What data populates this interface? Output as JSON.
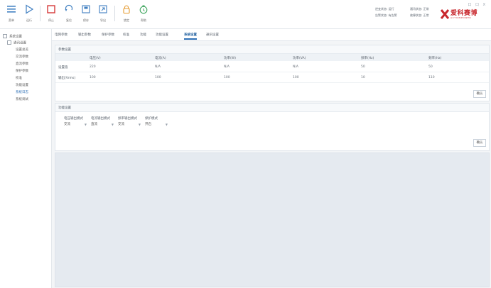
{
  "toolbar": {
    "items": [
      {
        "label": "菜单",
        "icon": "menu-icon",
        "color": "#3f7fc1"
      },
      {
        "label": "运行",
        "icon": "play-icon",
        "color": "#3f7fc1"
      },
      {
        "label": "停止",
        "icon": "stop-icon",
        "color": "#d63a3a"
      },
      {
        "label": "复位",
        "icon": "reset-icon",
        "color": "#3f7fc1"
      },
      {
        "label": "保存",
        "icon": "save-icon",
        "color": "#3f7fc1"
      },
      {
        "label": "导出",
        "icon": "export-icon",
        "color": "#3f7fc1"
      },
      {
        "label": "锁定",
        "icon": "lock-icon",
        "color": "#e59a2f"
      },
      {
        "label": "帮助",
        "icon": "help-icon",
        "color": "#3aa45a"
      }
    ]
  },
  "status": {
    "line1_left": "逆变状态: 运行",
    "line1_right": "通讯状态: 正常",
    "line2_left": "告警状态: 有告警",
    "line2_right": "故障状态: 正常"
  },
  "window_controls": "口 口 X",
  "logo": {
    "brand": "爱科赛博",
    "sub": "ACTIONPOWER",
    "accent": "#c8262c"
  },
  "sidebar": {
    "root": "系统设置",
    "group": "通讯设置",
    "items": [
      "设置总览",
      "交流参数",
      "直流参数",
      "保护参数",
      "校准",
      "功能设置",
      "系统日志",
      "系统调试"
    ]
  },
  "tabs": [
    "电网参数",
    "输出参数",
    "保护参数",
    "校准",
    "功能",
    "功能设置",
    "系统设置",
    "通讯设置"
  ],
  "active_tab_index": 6,
  "panel1": {
    "title": "参数设置",
    "headers": [
      "",
      "电压(V)",
      "电流(A)",
      "功率(W)",
      "功率(VA)",
      "频率(Hz)",
      "频率(Hz)"
    ],
    "rows": [
      {
        "label": "设置值",
        "values": [
          "220",
          "N/A",
          "N/A",
          "N/A",
          "50",
          "50"
        ]
      },
      {
        "label": "输出(Vrms)",
        "values": [
          "100",
          "100",
          "100",
          "100",
          "10",
          "110"
        ]
      }
    ],
    "apply": "确认"
  },
  "panel2": {
    "title": "功能设置",
    "fields": [
      {
        "label": "电压输出模式",
        "value": "交流"
      },
      {
        "label": "电流输出模式",
        "value": "直流"
      },
      {
        "label": "频率输出模式",
        "value": "交流"
      },
      {
        "label": "保护模式",
        "value": "开启"
      }
    ],
    "apply": "确认"
  }
}
